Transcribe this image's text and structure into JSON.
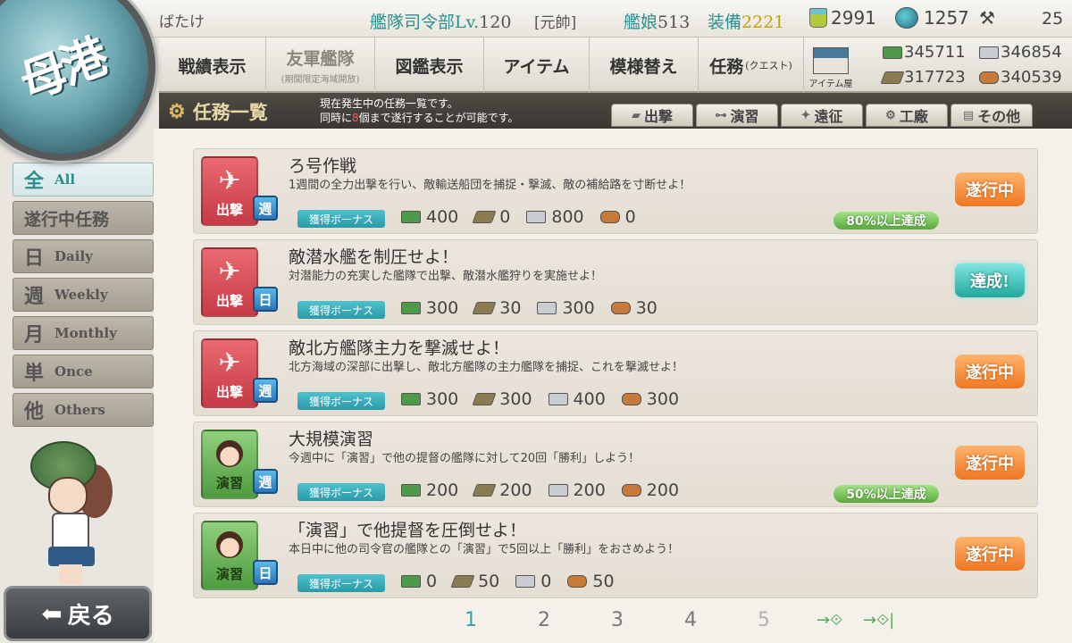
{
  "topbar": {
    "admiral_name": "ばたけ",
    "hq_label": "艦隊司令部",
    "lv_label": "Lv.",
    "hq_level": "120",
    "rank": "[元帥]",
    "ships_label": "艦娘",
    "ships": "513",
    "equip_label": "装備",
    "equip": "2221",
    "buckets": "2991",
    "flamethrowers": "1257",
    "dev_materials": "25"
  },
  "emblem": {
    "text": "母港"
  },
  "nav": {
    "record": "戦績表示",
    "friend_fleet": "友軍艦隊",
    "friend_fleet_sub": "(期間限定海域開放)",
    "album": "図鑑表示",
    "items": "アイテム",
    "furniture": "模様替え",
    "quest": "任務",
    "quest_sub": "(クエスト)",
    "item_shop": "アイテム屋"
  },
  "resources": {
    "fuel": "345711",
    "steel": "346854",
    "ammo": "317723",
    "bauxite": "340539"
  },
  "header": {
    "title": "任務一覧",
    "desc_line1": "現在発生中の任務一覧です。",
    "desc_line2_a": "同時に",
    "desc_line2_num": "8",
    "desc_line2_b": "個まで遂行することが可能です。"
  },
  "category_tabs": [
    {
      "label": "出撃"
    },
    {
      "label": "演習"
    },
    {
      "label": "遠征"
    },
    {
      "label": "工廠"
    },
    {
      "label": "その他"
    }
  ],
  "filters": [
    {
      "kanji": "全",
      "en": "All"
    },
    {
      "kanji": "遂行中任務",
      "en": ""
    },
    {
      "kanji": "日",
      "en": "Daily"
    },
    {
      "kanji": "週",
      "en": "Weekly"
    },
    {
      "kanji": "月",
      "en": "Monthly"
    },
    {
      "kanji": "単",
      "en": "Once"
    },
    {
      "kanji": "他",
      "en": "Others"
    }
  ],
  "quests": [
    {
      "type": "出撃",
      "period": "週",
      "name": "ろ号作戦",
      "detail": "1週間の全力出撃を行い、敵輸送船団を捕捉・撃滅、敵の補給路を寸断せよ！",
      "bonus": "獲得ボーナス",
      "fuel": "400",
      "ammo": "0",
      "steel": "800",
      "bauxite": "0",
      "progress": "80%以上達成",
      "state": "遂行中"
    },
    {
      "type": "出撃",
      "period": "日",
      "name": "敵潜水艦を制圧せよ！",
      "detail": "対潜能力の充実した艦隊で出撃、敵潜水艦狩りを実施せよ！",
      "bonus": "獲得ボーナス",
      "fuel": "300",
      "ammo": "30",
      "steel": "300",
      "bauxite": "30",
      "progress": "",
      "state": "達成!"
    },
    {
      "type": "出撃",
      "period": "週",
      "name": "敵北方艦隊主力を撃滅せよ！",
      "detail": "北方海域の深部に出撃し、敵北方艦隊の主力艦隊を捕捉、これを撃滅せよ！",
      "bonus": "獲得ボーナス",
      "fuel": "300",
      "ammo": "300",
      "steel": "400",
      "bauxite": "300",
      "progress": "",
      "state": "遂行中"
    },
    {
      "type": "演習",
      "period": "週",
      "name": "大規模演習",
      "detail": "今週中に「演習」で他の提督の艦隊に対して20回「勝利」しよう！",
      "bonus": "獲得ボーナス",
      "fuel": "200",
      "ammo": "200",
      "steel": "200",
      "bauxite": "200",
      "progress": "50%以上達成",
      "state": "遂行中"
    },
    {
      "type": "演習",
      "period": "日",
      "name": "「演習」で他提督を圧倒せよ！",
      "detail": "本日中に他の司令官の艦隊との「演習」で5回以上「勝利」をおさめよう！",
      "bonus": "獲得ボーナス",
      "fuel": "0",
      "ammo": "50",
      "steel": "0",
      "bauxite": "50",
      "progress": "",
      "state": "遂行中"
    }
  ],
  "pagination": {
    "pages": [
      "1",
      "2",
      "3",
      "4",
      "5"
    ],
    "current": "1"
  },
  "back_button": {
    "label": "戻る"
  },
  "colors": {
    "accent": "#2b8f8f",
    "in_progress": "#f07822",
    "complete": "#21a89e",
    "sortie": "#c73a45",
    "exercise": "#4f9b3f"
  }
}
